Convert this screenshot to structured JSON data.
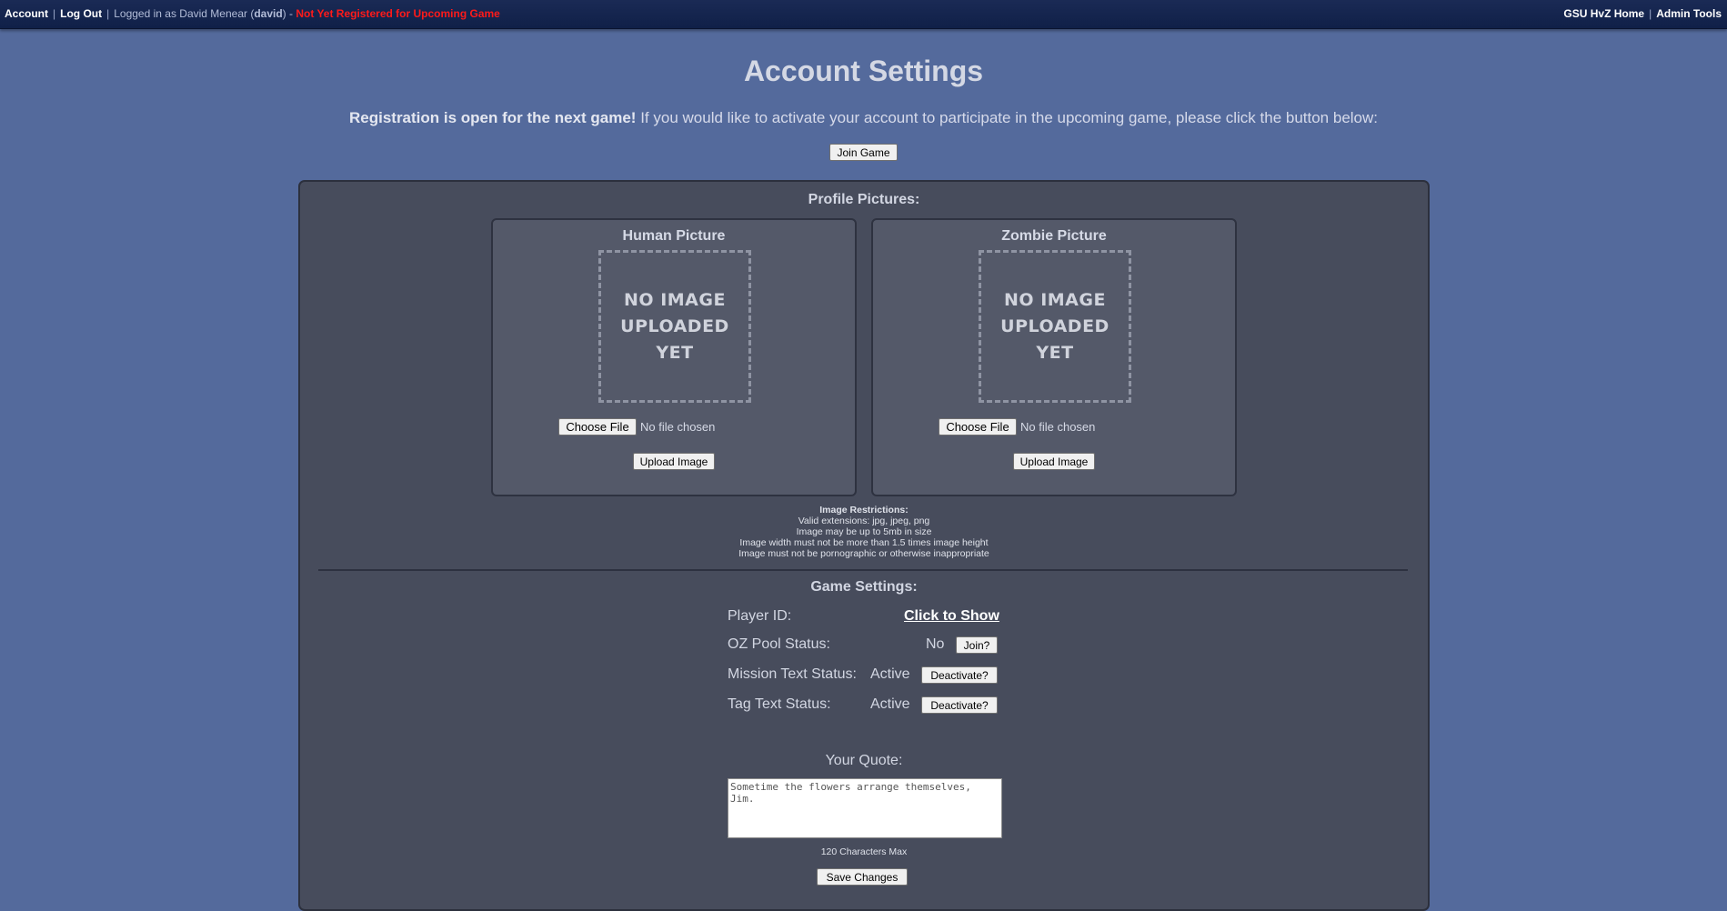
{
  "topbar": {
    "account": "Account",
    "logout": "Log Out",
    "logged_in_prefix": "Logged in as David Menear (",
    "username": "david",
    "logged_in_suffix": ") -",
    "registration_status": "Not Yet Registered for Upcoming Game",
    "home_link": "GSU HvZ Home",
    "admin_link": "Admin Tools",
    "separator": "|"
  },
  "page": {
    "title": "Account Settings",
    "registration_bold": "Registration is open for the next game!",
    "registration_text": " If you would like to activate your account to participate in the upcoming game, please click the button below:",
    "join_game_label": "Join Game"
  },
  "profile": {
    "section_title": "Profile Pictures:",
    "human": {
      "title": "Human Picture",
      "placeholder_lines": [
        "NO IMAGE",
        "UPLOADED",
        "YET"
      ],
      "choose_file": "Choose File",
      "no_file": "No file chosen",
      "upload": "Upload Image"
    },
    "zombie": {
      "title": "Zombie Picture",
      "placeholder_lines": [
        "NO IMAGE",
        "UPLOADED",
        "YET"
      ],
      "choose_file": "Choose File",
      "no_file": "No file chosen",
      "upload": "Upload Image"
    },
    "restrictions": {
      "heading": "Image Restrictions:",
      "lines": [
        "Valid extensions: jpg, jpeg, png",
        "Image may be up to 5mb in size",
        "Image width must not be more than 1.5 times image height",
        "Image must not be pornographic or otherwise inappropriate"
      ]
    }
  },
  "game_settings": {
    "section_title": "Game Settings:",
    "player_id_label": "Player ID:",
    "player_id_action": "Click to Show",
    "oz_label": "OZ Pool Status:",
    "oz_value": "No",
    "oz_button": "Join?",
    "mission_label": "Mission Text Status:",
    "mission_value": "Active",
    "mission_button": "Deactivate?",
    "tag_label": "Tag Text Status:",
    "tag_value": "Active",
    "tag_button": "Deactivate?"
  },
  "quote": {
    "label": "Your Quote:",
    "value": "Sometime the flowers arrange themselves, Jim.",
    "limit": "120 Characters Max",
    "save_label": "Save Changes"
  }
}
